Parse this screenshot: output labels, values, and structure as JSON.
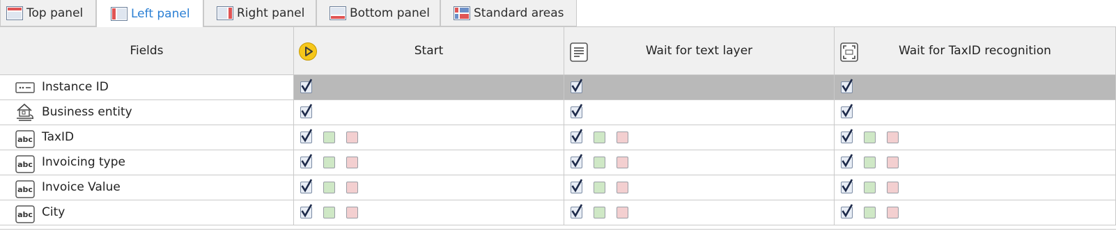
{
  "tabs": [
    {
      "label": "Top panel",
      "icon": "top-panel-icon",
      "active": false
    },
    {
      "label": "Left panel",
      "icon": "left-panel-icon",
      "active": true
    },
    {
      "label": "Right panel",
      "icon": "right-panel-icon",
      "active": false
    },
    {
      "label": "Bottom panel",
      "icon": "bottom-panel-icon",
      "active": false
    },
    {
      "label": "Standard areas",
      "icon": "standard-areas-icon",
      "active": false
    }
  ],
  "grid": {
    "fields_header": "Fields",
    "columns": [
      {
        "label": "Start",
        "icon": "start-play-icon"
      },
      {
        "label": "Wait for text layer",
        "icon": "text-layer-icon"
      },
      {
        "label": "Wait for TaxID recognition",
        "icon": "recognition-icon"
      }
    ],
    "rows": [
      {
        "label": "Instance ID",
        "icon": "instance-id-icon",
        "selected": true,
        "checked": true,
        "extra_boxes": false
      },
      {
        "label": "Business entity",
        "icon": "business-entity-icon",
        "selected": false,
        "checked": true,
        "extra_boxes": false
      },
      {
        "label": "TaxID",
        "icon": "abc-text-field-icon",
        "selected": false,
        "checked": true,
        "extra_boxes": true
      },
      {
        "label": "Invoicing type",
        "icon": "abc-text-field-icon",
        "selected": false,
        "checked": true,
        "extra_boxes": true
      },
      {
        "label": "Invoice Value",
        "icon": "abc-text-field-icon",
        "selected": false,
        "checked": true,
        "extra_boxes": true
      },
      {
        "label": "City",
        "icon": "abc-text-field-icon",
        "selected": false,
        "checked": true,
        "extra_boxes": true
      }
    ]
  },
  "colors": {
    "accent": "#2a7fd4",
    "header_bg": "#f0f0f0",
    "selected_row": "#b9b9b9",
    "green_box": "#cfe8c6",
    "pink_box": "#f3cfd0"
  }
}
